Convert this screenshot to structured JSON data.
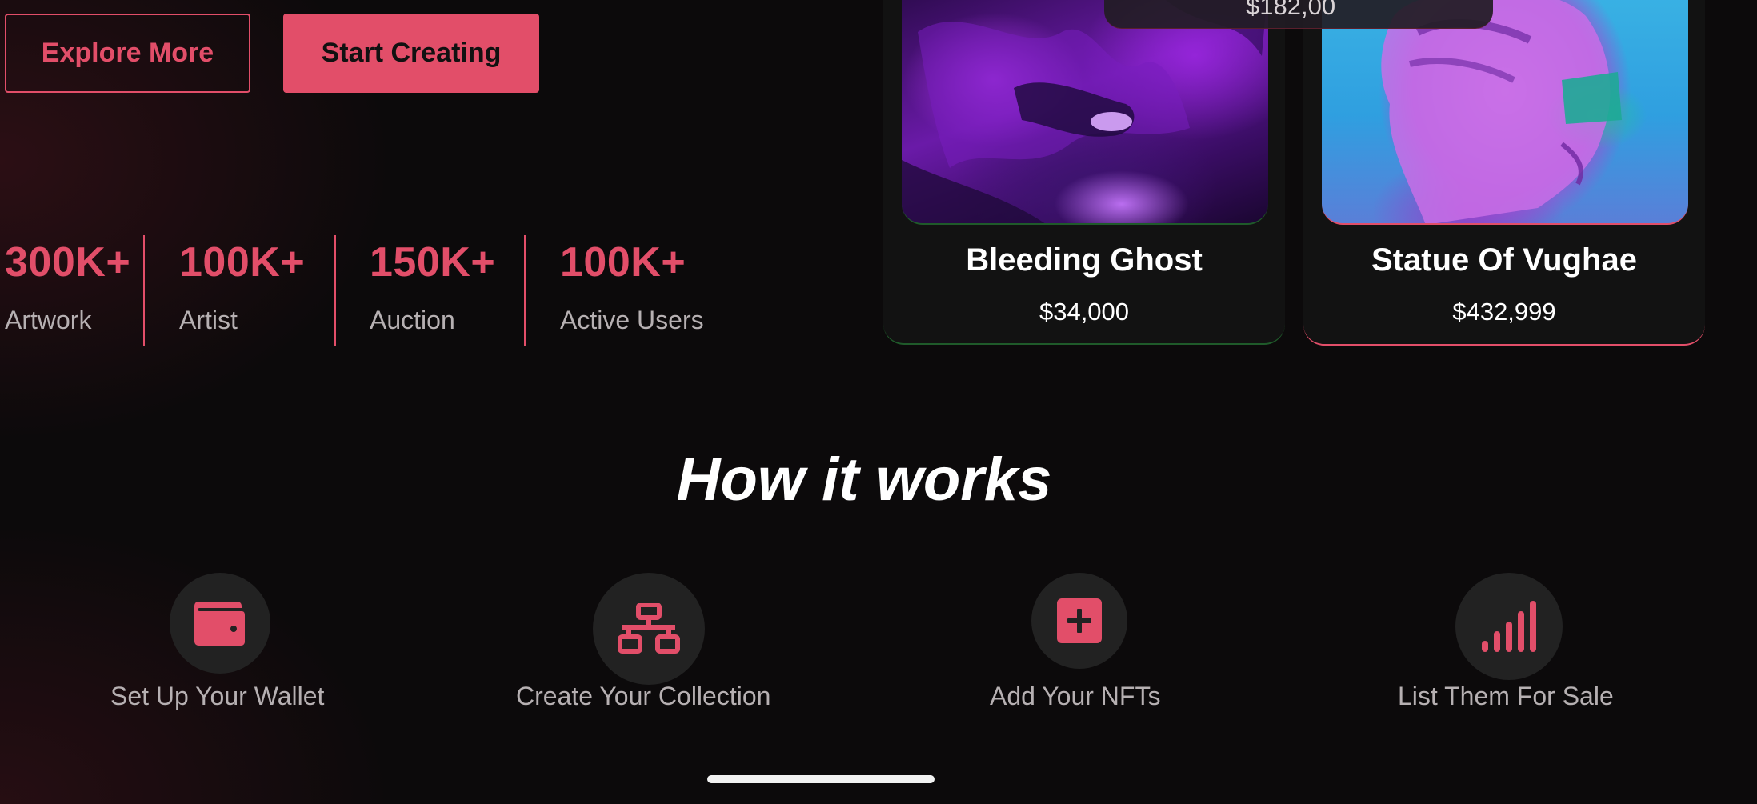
{
  "hero": {
    "explore_label": "Explore More",
    "create_label": "Start Creating"
  },
  "stats": [
    {
      "value": "300K+",
      "label": "Artwork"
    },
    {
      "value": "100K+",
      "label": "Artist"
    },
    {
      "value": "150K+",
      "label": "Auction"
    },
    {
      "value": "100K+",
      "label": "Active Users"
    }
  ],
  "cards": [
    {
      "title": "Bleeding Ghost",
      "price": "$34,000"
    },
    {
      "title": "Statue Of Vughae",
      "price": "$432,999"
    }
  ],
  "partial_price": "$182,00",
  "how_it_works": {
    "title": "How it works",
    "steps": [
      {
        "label": "Set Up Your Wallet",
        "icon": "wallet-icon"
      },
      {
        "label": "Create Your Collection",
        "icon": "network-icon"
      },
      {
        "label": "Add Your NFTs",
        "icon": "plus-square-icon"
      },
      {
        "label": "List Them For Sale",
        "icon": "signal-bars-icon"
      }
    ]
  },
  "colors": {
    "accent": "#e24e69",
    "background": "#0c0a0b",
    "card": "#121212",
    "icon_circle": "#222222"
  }
}
